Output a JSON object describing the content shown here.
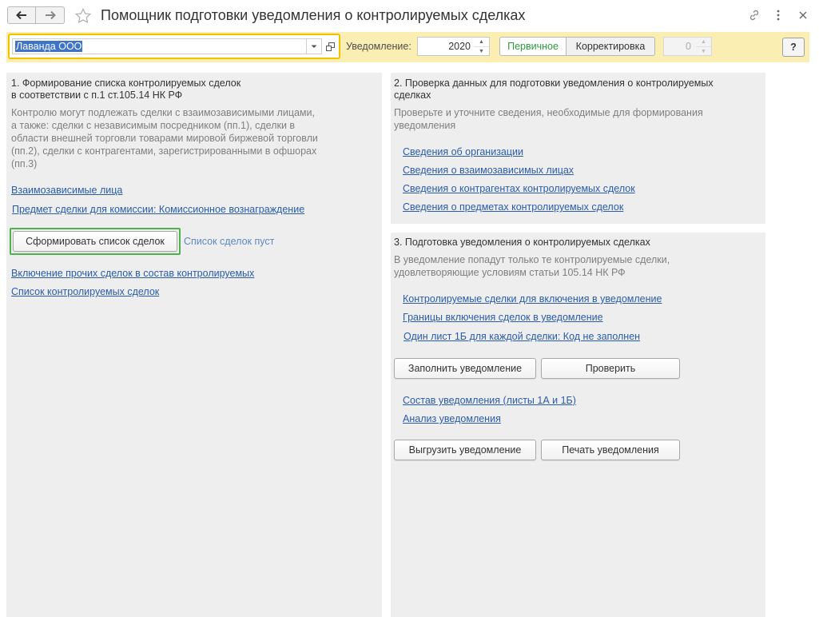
{
  "window": {
    "title": "Помощник подготовки уведомления о контролируемых сделках"
  },
  "toolbar": {
    "organization": "Лаванда ООО",
    "notice_label": "Уведомление:",
    "year": "2020",
    "primary_label": "Первичное",
    "correction_label": "Корректировка",
    "correction_number": "0",
    "help_label": "?"
  },
  "section1": {
    "title_line1": "1. Формирование списка контролируемых сделок",
    "title_line2": "в соответствии с п.1 ст.105.14 НК РФ",
    "desc_lines": [
      "Контролю могут подлежать сделки с взаимозависимыми лицами,",
      "а также: сделки с независимым посредником (пп.1), сделки в",
      "области внешней торговли товарами мировой биржевой торговли",
      "(пп.2), сделки с контрагентами, зарегистрированными в офшорах",
      "(пп.3)"
    ],
    "link_related": "Взаимозависимые лица",
    "link_subject": "Предмет сделки для комиссии: Комиссионное вознаграждение",
    "btn_form": "Сформировать список сделок",
    "status_empty": "Список сделок пуст",
    "link_include_other": "Включение прочих сделок в состав контролируемых",
    "link_list": "Список контролируемых сделок"
  },
  "section2": {
    "title_line1": "2. Проверка данных для подготовки уведомления о контролируемых",
    "title_line2": "сделках",
    "desc_line1": "Проверьте и уточните сведения, необходимые для формирования",
    "desc_line2": "уведомления",
    "links": [
      "Сведения об организации",
      "Сведения о взаимозависимых лицах",
      "Сведения о контрагентах контролируемых сделок",
      "Сведения о предметах контролируемых сделок"
    ]
  },
  "section3": {
    "title": "3. Подготовка уведомления о контролируемых сделках",
    "desc_line1": "В уведомление попадут только те контролируемые сделки,",
    "desc_line2": "удовлетворяющие условиям статьи 105.14 НК РФ",
    "link_deals": "Контролируемые сделки для включения в уведомление",
    "link_bounds": "Границы включения сделок в уведомление",
    "link_sheet": "Один лист 1Б для каждой сделки: Код не заполнен",
    "btn_fill": "Заполнить уведомление",
    "btn_check": "Проверить",
    "link_composition": "Состав уведомления (листы 1А и 1Б)",
    "link_analysis": "Анализ уведомления",
    "btn_export": "Выгрузить уведомление",
    "btn_print": "Печать уведомления"
  },
  "colors": {
    "toolbar_bg": "#fbeeb2",
    "panel_bg": "#eeeeee",
    "link": "#2a5cac",
    "focus_green": "#4cb34c",
    "primary_green": "#2a9a3e",
    "selection_blue": "#3d74c9"
  }
}
